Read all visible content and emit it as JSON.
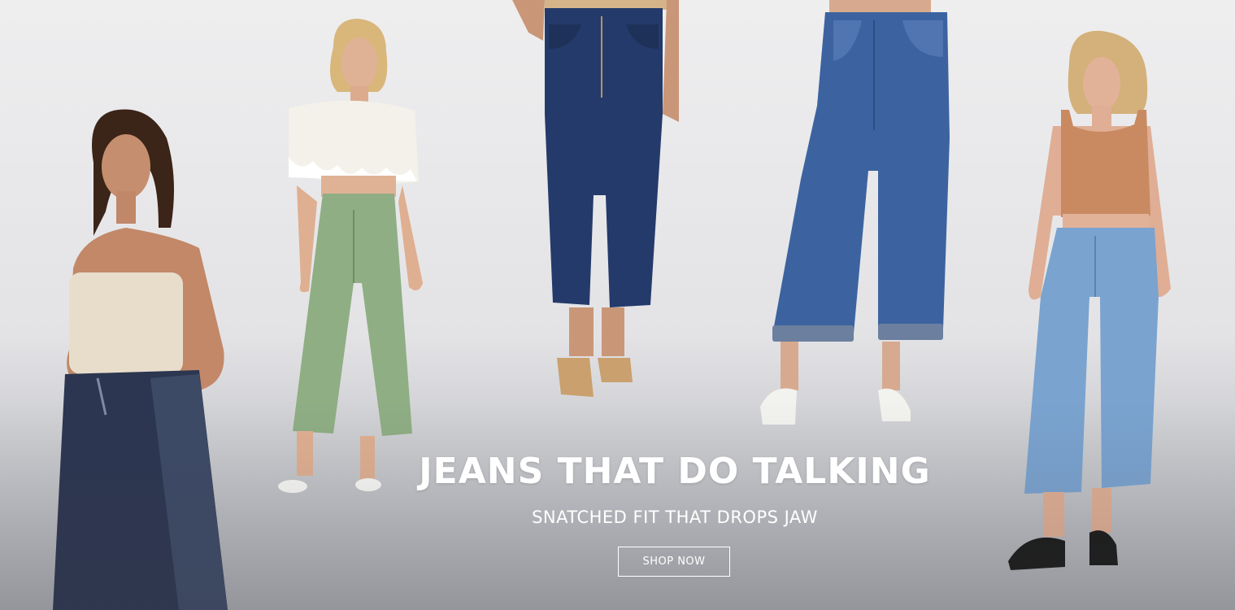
{
  "hero": {
    "headline": "JEANS THAT DO TALKING",
    "subheadline": "SNATCHED FIT THAT DROPS JAW",
    "cta_label": "SHOP NOW"
  },
  "models": [
    {
      "name": "model-white-bandeau-dark-wide-jeans"
    },
    {
      "name": "model-eyelet-top-green-jeans"
    },
    {
      "name": "dark-wash-cropped-wide-jeans"
    },
    {
      "name": "medium-wash-cuffed-bootcut-jeans"
    },
    {
      "name": "model-tank-light-wash-wide-jeans"
    }
  ],
  "colors": {
    "text": "#ffffff",
    "dark_denim": "#243a6a",
    "medium_denim": "#3c63a0",
    "light_denim": "#7aa3cf",
    "sage": "#8fae84",
    "rust": "#c98a62"
  }
}
